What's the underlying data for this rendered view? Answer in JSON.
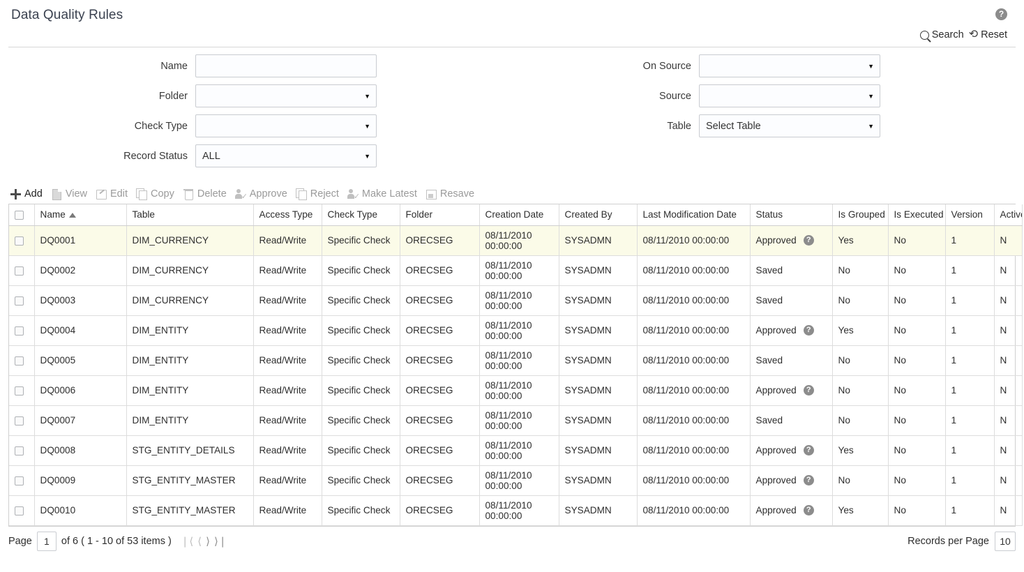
{
  "header": {
    "title": "Data Quality Rules",
    "help_icon": "help-circle-icon",
    "search_label": "Search",
    "reset_label": "Reset"
  },
  "search_form": {
    "left": [
      {
        "label": "Name",
        "type": "text",
        "value": "",
        "placeholder": ""
      },
      {
        "label": "Folder",
        "type": "select",
        "value": ""
      },
      {
        "label": "Check Type",
        "type": "select",
        "value": ""
      },
      {
        "label": "Record Status",
        "type": "select",
        "value": "ALL"
      }
    ],
    "right": [
      {
        "label": "On Source",
        "type": "select",
        "value": ""
      },
      {
        "label": "Source",
        "type": "select",
        "value": ""
      },
      {
        "label": "Table",
        "type": "select",
        "value": "Select Table"
      }
    ]
  },
  "toolbar": [
    {
      "label": "Add",
      "icon": "plus-icon",
      "enabled": true
    },
    {
      "label": "View",
      "icon": "document-icon",
      "enabled": false
    },
    {
      "label": "Edit",
      "icon": "pencil-icon",
      "enabled": false
    },
    {
      "label": "Copy",
      "icon": "copy-icon",
      "enabled": false
    },
    {
      "label": "Delete",
      "icon": "trash-icon",
      "enabled": false
    },
    {
      "label": "Approve",
      "icon": "person-check-icon",
      "enabled": false
    },
    {
      "label": "Reject",
      "icon": "copy-icon",
      "enabled": false
    },
    {
      "label": "Make Latest",
      "icon": "person-check-icon",
      "enabled": false
    },
    {
      "label": "Resave",
      "icon": "save-icon",
      "enabled": false
    }
  ],
  "grid": {
    "columns": [
      "Name",
      "Table",
      "Access Type",
      "Check Type",
      "Folder",
      "Creation Date",
      "Created By",
      "Last Modification Date",
      "Status",
      "Is Grouped",
      "Is Executed",
      "Version",
      "Active"
    ],
    "sort": {
      "column": "Name",
      "direction": "asc"
    },
    "rows": [
      {
        "selected": true,
        "checked": false,
        "name": "DQ0001",
        "table": "DIM_CURRENCY",
        "access_type": "Read/Write",
        "check_type": "Specific Check",
        "folder": "ORECSEG",
        "creation_date": "08/11/2010 00:00:00",
        "created_by": "SYSADMN",
        "last_modification_date": "08/11/2010 00:00:00",
        "status": "Approved",
        "has_status_help": true,
        "is_grouped": "Yes",
        "is_executed": "No",
        "version": "1",
        "active": "N"
      },
      {
        "selected": false,
        "checked": false,
        "name": "DQ0002",
        "table": "DIM_CURRENCY",
        "access_type": "Read/Write",
        "check_type": "Specific Check",
        "folder": "ORECSEG",
        "creation_date": "08/11/2010 00:00:00",
        "created_by": "SYSADMN",
        "last_modification_date": "08/11/2010 00:00:00",
        "status": "Saved",
        "has_status_help": false,
        "is_grouped": "No",
        "is_executed": "No",
        "version": "1",
        "active": "N"
      },
      {
        "selected": false,
        "checked": false,
        "name": "DQ0003",
        "table": "DIM_CURRENCY",
        "access_type": "Read/Write",
        "check_type": "Specific Check",
        "folder": "ORECSEG",
        "creation_date": "08/11/2010 00:00:00",
        "created_by": "SYSADMN",
        "last_modification_date": "08/11/2010 00:00:00",
        "status": "Saved",
        "has_status_help": false,
        "is_grouped": "No",
        "is_executed": "No",
        "version": "1",
        "active": "N"
      },
      {
        "selected": false,
        "checked": false,
        "name": "DQ0004",
        "table": "DIM_ENTITY",
        "access_type": "Read/Write",
        "check_type": "Specific Check",
        "folder": "ORECSEG",
        "creation_date": "08/11/2010 00:00:00",
        "created_by": "SYSADMN",
        "last_modification_date": "08/11/2010 00:00:00",
        "status": "Approved",
        "has_status_help": true,
        "is_grouped": "Yes",
        "is_executed": "No",
        "version": "1",
        "active": "N"
      },
      {
        "selected": false,
        "checked": false,
        "name": "DQ0005",
        "table": "DIM_ENTITY",
        "access_type": "Read/Write",
        "check_type": "Specific Check",
        "folder": "ORECSEG",
        "creation_date": "08/11/2010 00:00:00",
        "created_by": "SYSADMN",
        "last_modification_date": "08/11/2010 00:00:00",
        "status": "Saved",
        "has_status_help": false,
        "is_grouped": "No",
        "is_executed": "No",
        "version": "1",
        "active": "N"
      },
      {
        "selected": false,
        "checked": false,
        "name": "DQ0006",
        "table": "DIM_ENTITY",
        "access_type": "Read/Write",
        "check_type": "Specific Check",
        "folder": "ORECSEG",
        "creation_date": "08/11/2010 00:00:00",
        "created_by": "SYSADMN",
        "last_modification_date": "08/11/2010 00:00:00",
        "status": "Approved",
        "has_status_help": true,
        "is_grouped": "No",
        "is_executed": "No",
        "version": "1",
        "active": "N"
      },
      {
        "selected": false,
        "checked": false,
        "name": "DQ0007",
        "table": "DIM_ENTITY",
        "access_type": "Read/Write",
        "check_type": "Specific Check",
        "folder": "ORECSEG",
        "creation_date": "08/11/2010 00:00:00",
        "created_by": "SYSADMN",
        "last_modification_date": "08/11/2010 00:00:00",
        "status": "Saved",
        "has_status_help": false,
        "is_grouped": "No",
        "is_executed": "No",
        "version": "1",
        "active": "N"
      },
      {
        "selected": false,
        "checked": false,
        "name": "DQ0008",
        "table": "STG_ENTITY_DETAILS",
        "access_type": "Read/Write",
        "check_type": "Specific Check",
        "folder": "ORECSEG",
        "creation_date": "08/11/2010 00:00:00",
        "created_by": "SYSADMN",
        "last_modification_date": "08/11/2010 00:00:00",
        "status": "Approved",
        "has_status_help": true,
        "is_grouped": "Yes",
        "is_executed": "No",
        "version": "1",
        "active": "N"
      },
      {
        "selected": false,
        "checked": false,
        "name": "DQ0009",
        "table": "STG_ENTITY_MASTER",
        "access_type": "Read/Write",
        "check_type": "Specific Check",
        "folder": "ORECSEG",
        "creation_date": "08/11/2010 00:00:00",
        "created_by": "SYSADMN",
        "last_modification_date": "08/11/2010 00:00:00",
        "status": "Approved",
        "has_status_help": true,
        "is_grouped": "No",
        "is_executed": "No",
        "version": "1",
        "active": "N"
      },
      {
        "selected": false,
        "checked": false,
        "name": "DQ0010",
        "table": "STG_ENTITY_MASTER",
        "access_type": "Read/Write",
        "check_type": "Specific Check",
        "folder": "ORECSEG",
        "creation_date": "08/11/2010 00:00:00",
        "created_by": "SYSADMN",
        "last_modification_date": "08/11/2010 00:00:00",
        "status": "Approved",
        "has_status_help": true,
        "is_grouped": "Yes",
        "is_executed": "No",
        "version": "1",
        "active": "N"
      }
    ]
  },
  "footer": {
    "page_label": "Page",
    "page_value": "1",
    "page_info": "of 6 ( 1 - 10 of 53 items )",
    "records_per_page_label": "Records per Page",
    "records_per_page_value": "10",
    "nav": {
      "first": "❘⟨",
      "prev": "⟨",
      "next": "⟩",
      "last": "⟩❘"
    }
  },
  "colors": {
    "selected_row": "#fbfbe8",
    "help_icon": "#8c8c8c",
    "border": "#dddddd",
    "title_text": "#3b4250"
  }
}
